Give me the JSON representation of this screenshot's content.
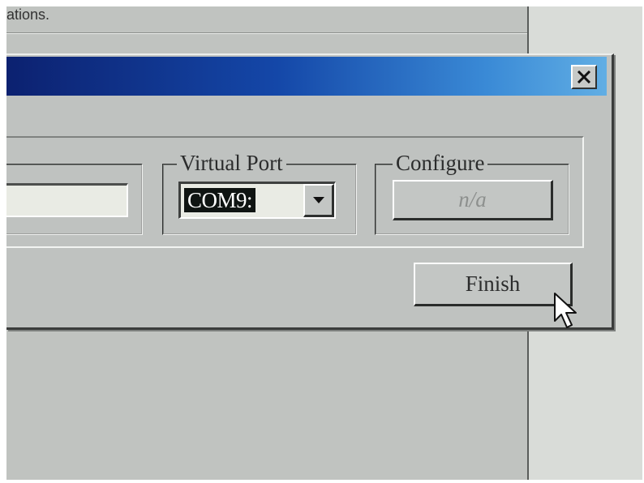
{
  "background_window": {
    "partial_text": "ations."
  },
  "dialog": {
    "title": "",
    "close_glyph": "✕",
    "port_group": {
      "label": "Virtual Port",
      "selected_value": "COM9:"
    },
    "configure_group": {
      "label": "Configure",
      "button_label": "n/a"
    },
    "finish_button_label": "Finish"
  },
  "colors": {
    "titlebar_start": "#0c2170",
    "titlebar_end": "#61aee4",
    "face": "#bfc2c0"
  },
  "icons": {
    "close": "close-icon",
    "dropdown": "chevron-down-icon",
    "cursor": "mouse-pointer-icon"
  }
}
